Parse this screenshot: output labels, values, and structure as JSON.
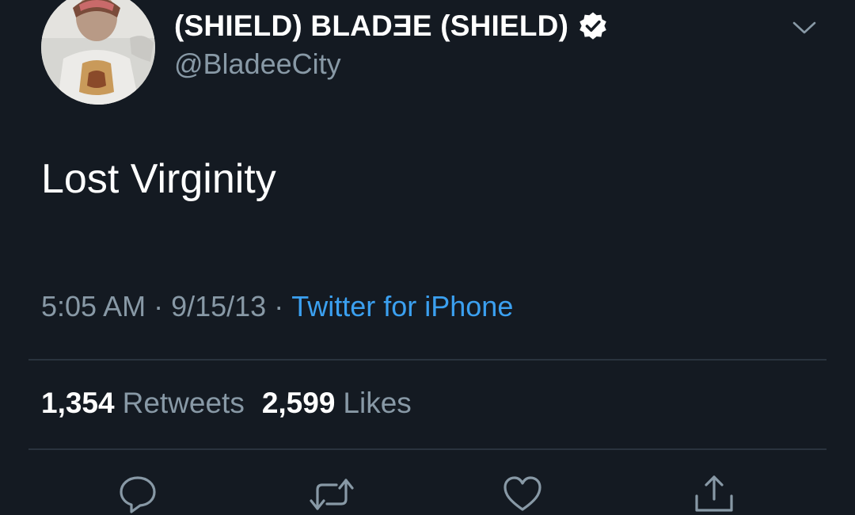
{
  "user": {
    "display_name": "(SHIELD) BLADƎE (SHIELD)",
    "handle": "@BladeeCity",
    "verified": true
  },
  "tweet": {
    "text": "Lost Virginity",
    "time": "5:05 AM",
    "date": "9/15/13",
    "separator": "·",
    "source": "Twitter for iPhone"
  },
  "stats": {
    "retweets_count": "1,354",
    "retweets_label": "Retweets",
    "likes_count": "2,599",
    "likes_label": "Likes"
  },
  "colors": {
    "background": "#141a22",
    "secondary_text": "#8899a6",
    "link": "#3ba0f0"
  },
  "icons": {
    "verified": "verified-badge-icon",
    "caret": "chevron-down-icon",
    "reply": "reply-icon",
    "retweet": "retweet-icon",
    "like": "heart-icon",
    "share": "share-icon"
  }
}
